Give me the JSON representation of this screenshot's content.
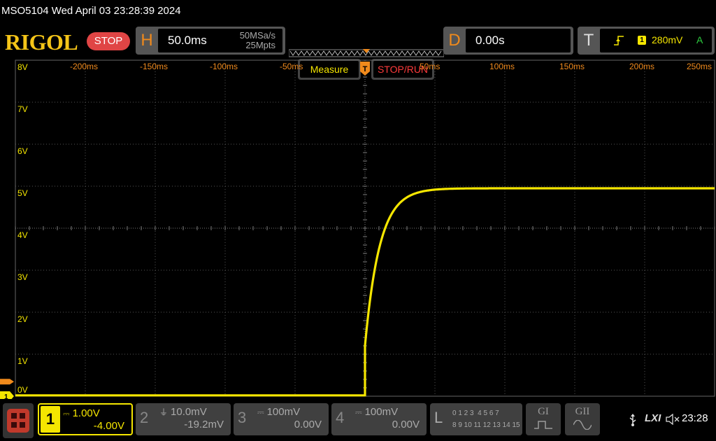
{
  "title_bar": {
    "text": "MSO5104  Wed April 03 23:28:39 2024"
  },
  "header": {
    "logo": "RIGOL",
    "run_status": "STOP",
    "horizontal": {
      "letter": "H",
      "timebase": "50.0ms",
      "sample_rate": "50MSa/s",
      "memory_depth": "25Mpts"
    },
    "measure_label": "Measure",
    "stoprun_label": "STOP/RUN",
    "delay": {
      "letter": "D",
      "value": "0.00s"
    },
    "trigger": {
      "letter": "T",
      "source": "1",
      "level": "280mV",
      "mode": "A",
      "edge_icon": "rising-edge-icon"
    }
  },
  "graticule": {
    "voltage_labels": [
      "8V",
      "7V",
      "6V",
      "5V",
      "4V",
      "3V",
      "2V",
      "1V",
      "0V"
    ],
    "time_labels": [
      "-200ms",
      "-150ms",
      "-100ms",
      "-50ms",
      "50ms",
      "100ms",
      "150ms",
      "200ms",
      "250ms"
    ],
    "ground_marker": "1",
    "trigger_marker": "T"
  },
  "waveform": {
    "channel": "1",
    "color": "#f5e600",
    "description_points_v": {
      "baseline": 0.0,
      "step_start": 1.2,
      "settle": 4.95
    },
    "step_time_ms": 0
  },
  "channels": [
    {
      "num": "1",
      "coupling": "DC",
      "scale": "1.00V",
      "offset": "-4.00V",
      "active": true
    },
    {
      "num": "2",
      "coupling": "GND",
      "scale": "10.0mV",
      "offset": "-19.2mV",
      "active": false
    },
    {
      "num": "3",
      "coupling": "DC",
      "scale": "100mV",
      "offset": "0.00V",
      "active": false
    },
    {
      "num": "4",
      "coupling": "DC",
      "scale": "100mV",
      "offset": "0.00V",
      "active": false
    }
  ],
  "logic": {
    "letter": "L",
    "row1": "0 1 2 3  4 5 6 7",
    "row2": "8 9 10 11 12 13 14 15"
  },
  "generators": [
    {
      "label": "GI"
    },
    {
      "label": "GII"
    }
  ],
  "status": {
    "lxi": "LXI",
    "clock": "23:28"
  },
  "colors": {
    "ch1": "#f5e600",
    "accent_orange": "#f08a1c",
    "stop_red": "#e04545",
    "grid": "#555555"
  }
}
